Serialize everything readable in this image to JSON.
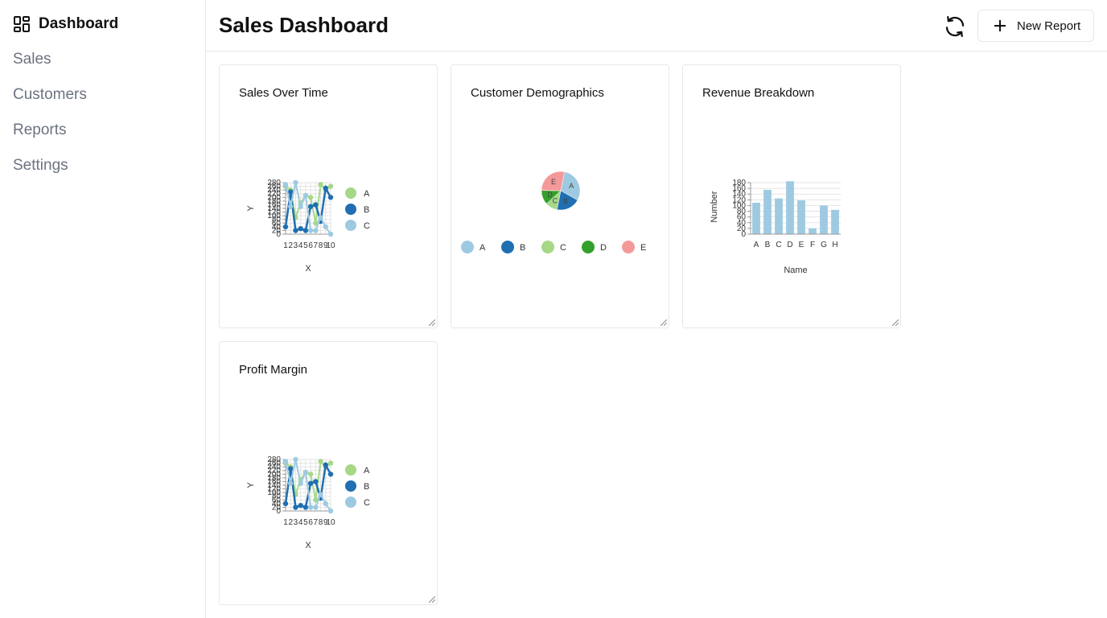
{
  "sidebar": {
    "items": [
      {
        "label": "Dashboard",
        "icon": "dashboard-icon",
        "active": true
      },
      {
        "label": "Sales"
      },
      {
        "label": "Customers"
      },
      {
        "label": "Reports"
      },
      {
        "label": "Settings"
      }
    ]
  },
  "header": {
    "title": "Sales Dashboard",
    "refresh_icon": "refresh-icon",
    "new_report_label": "New Report"
  },
  "cards": {
    "sales_over_time": {
      "title": "Sales Over Time"
    },
    "customer_demographics": {
      "title": "Customer Demographics"
    },
    "revenue_breakdown": {
      "title": "Revenue Breakdown"
    },
    "profit_margin": {
      "title": "Profit Margin"
    }
  },
  "chart_data": [
    {
      "type": "line",
      "xlabel": "X",
      "ylabel": "Y",
      "x": [
        1,
        2,
        3,
        4,
        5,
        6,
        7,
        8,
        9,
        10
      ],
      "ylim": [
        0,
        280
      ],
      "yticks": [
        0,
        20,
        40,
        60,
        80,
        100,
        120,
        140,
        160,
        180,
        200,
        220,
        240,
        260,
        280
      ],
      "series": [
        {
          "name": "A",
          "color": "#a6d887",
          "values": [
            260,
            240,
            90,
            170,
            210,
            200,
            60,
            270,
            240,
            260
          ]
        },
        {
          "name": "B",
          "color": "#1f6fb2",
          "values": [
            40,
            230,
            20,
            30,
            20,
            150,
            160,
            70,
            250,
            200
          ]
        },
        {
          "name": "C",
          "color": "#9ecae1",
          "values": [
            270,
            150,
            280,
            150,
            210,
            20,
            20,
            90,
            40,
            0
          ]
        }
      ]
    },
    {
      "type": "pie",
      "slices": [
        {
          "name": "A",
          "value": 30,
          "color": "#9ecae1"
        },
        {
          "name": "B",
          "value": 20,
          "color": "#1f6fb2"
        },
        {
          "name": "C",
          "value": 10,
          "color": "#a6d887"
        },
        {
          "name": "D",
          "value": 12,
          "color": "#33a02c"
        },
        {
          "name": "E",
          "value": 28,
          "color": "#f4999a"
        }
      ]
    },
    {
      "type": "bar",
      "xlabel": "Name",
      "ylabel": "Number",
      "categories": [
        "A",
        "B",
        "C",
        "D",
        "E",
        "F",
        "G",
        "H"
      ],
      "values": [
        110,
        155,
        125,
        185,
        118,
        20,
        100,
        85
      ],
      "ylim": [
        0,
        180
      ],
      "yticks": [
        0,
        20,
        40,
        60,
        80,
        100,
        120,
        140,
        160,
        180
      ],
      "color": "#9ecae1"
    },
    {
      "type": "line",
      "xlabel": "X",
      "ylabel": "Y",
      "x": [
        1,
        2,
        3,
        4,
        5,
        6,
        7,
        8,
        9,
        10
      ],
      "ylim": [
        0,
        280
      ],
      "yticks": [
        0,
        20,
        40,
        60,
        80,
        100,
        120,
        140,
        160,
        180,
        200,
        220,
        240,
        260,
        280
      ],
      "series": [
        {
          "name": "A",
          "color": "#a6d887",
          "values": [
            260,
            240,
            90,
            170,
            210,
            200,
            60,
            270,
            240,
            260
          ]
        },
        {
          "name": "B",
          "color": "#1f6fb2",
          "values": [
            40,
            230,
            20,
            30,
            20,
            150,
            160,
            70,
            250,
            200
          ]
        },
        {
          "name": "C",
          "color": "#9ecae1",
          "values": [
            270,
            150,
            280,
            150,
            210,
            20,
            20,
            90,
            40,
            0
          ]
        }
      ]
    }
  ]
}
